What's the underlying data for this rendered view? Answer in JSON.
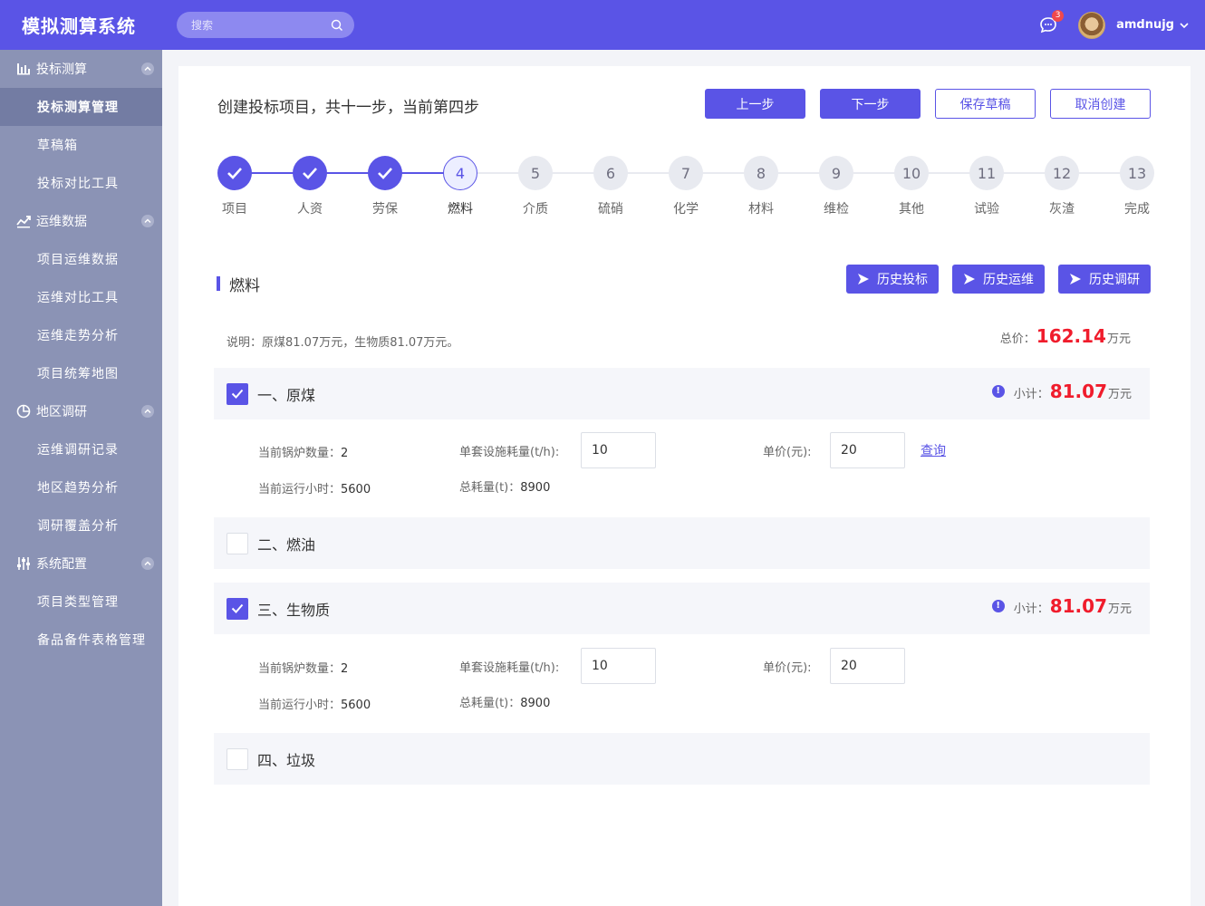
{
  "app": {
    "title": "模拟测算系统"
  },
  "search": {
    "placeholder": "搜索"
  },
  "header": {
    "badge_count": "3",
    "username": "amdnujg"
  },
  "sidebar": {
    "groups": [
      {
        "label": "投标测算",
        "items": [
          "投标测算管理",
          "草稿箱",
          "投标对比工具"
        ]
      },
      {
        "label": "运维数据",
        "items": [
          "项目运维数据",
          "运维对比工具",
          "运维走势分析",
          "项目统筹地图"
        ]
      },
      {
        "label": "地区调研",
        "items": [
          "运维调研记录",
          "地区趋势分析",
          "调研覆盖分析"
        ]
      },
      {
        "label": "系统配置",
        "items": [
          "项目类型管理",
          "备品备件表格管理"
        ]
      }
    ]
  },
  "page": {
    "title": "创建投标项目，共十一步，当前第四步",
    "buttons": {
      "prev": "上一步",
      "next": "下一步",
      "save": "保存草稿",
      "cancel": "取消创建"
    }
  },
  "steps": [
    {
      "num": "1",
      "label": "项目",
      "state": "done"
    },
    {
      "num": "2",
      "label": "人资",
      "state": "done"
    },
    {
      "num": "3",
      "label": "劳保",
      "state": "done"
    },
    {
      "num": "4",
      "label": "燃料",
      "state": "current"
    },
    {
      "num": "5",
      "label": "介质",
      "state": "todo"
    },
    {
      "num": "6",
      "label": "硫硝",
      "state": "todo"
    },
    {
      "num": "7",
      "label": "化学",
      "state": "todo"
    },
    {
      "num": "8",
      "label": "材料",
      "state": "todo"
    },
    {
      "num": "9",
      "label": "维检",
      "state": "todo"
    },
    {
      "num": "10",
      "label": "其他",
      "state": "todo"
    },
    {
      "num": "11",
      "label": "试验",
      "state": "todo"
    },
    {
      "num": "12",
      "label": "灰渣",
      "state": "todo"
    },
    {
      "num": "13",
      "label": "完成",
      "state": "todo"
    }
  ],
  "section": {
    "title": "燃料",
    "history_buttons": [
      "历史投标",
      "历史运维",
      "历史调研"
    ],
    "note": "说明：原煤81.07万元，生物质81.07万元。",
    "total_label": "总价：",
    "total_value": "162.14",
    "unit": "万元"
  },
  "items": [
    {
      "title": "一、原煤",
      "checked": true,
      "subtotal_label": "小计：",
      "subtotal": "81.07",
      "unit": "万元",
      "boiler_label": "当前锅炉数量：",
      "boiler": "2",
      "hours_label": "当前运行小时：",
      "hours": "5600",
      "consumption_label": "单套设施耗量(t/h):",
      "consumption": "10",
      "total_consumption_label": "总耗量(t)：",
      "total_consumption": "8900",
      "price_label": "单价(元):",
      "price": "20",
      "query": "查询"
    },
    {
      "title": "二、燃油",
      "checked": false
    },
    {
      "title": "三、生物质",
      "checked": true,
      "subtotal_label": "小计：",
      "subtotal": "81.07",
      "unit": "万元",
      "boiler_label": "当前锅炉数量：",
      "boiler": "2",
      "hours_label": "当前运行小时：",
      "hours": "5600",
      "consumption_label": "单套设施耗量(t/h):",
      "consumption": "10",
      "total_consumption_label": "总耗量(t)：",
      "total_consumption": "8900",
      "price_label": "单价(元):",
      "price": "20"
    },
    {
      "title": "四、垃圾",
      "checked": false
    }
  ],
  "colors": {
    "accent": "#5a54e6",
    "sidebar": "#8b93b5",
    "price_red": "#f01c2c"
  }
}
